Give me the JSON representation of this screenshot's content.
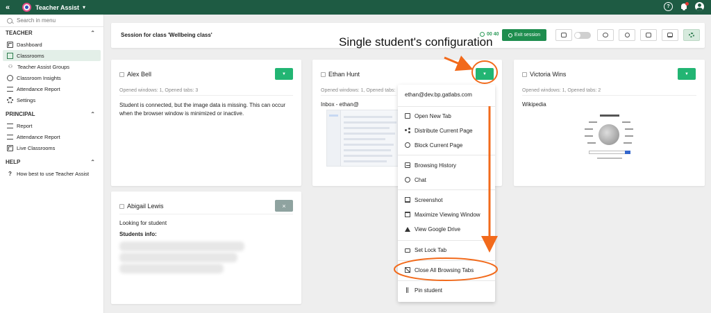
{
  "app": {
    "title": "Teacher Assist"
  },
  "sidebar": {
    "search_placeholder": "Search in menu",
    "sections": [
      {
        "title": "TEACHER",
        "items": [
          "Dashboard",
          "Classrooms",
          "Teacher Assist Groups",
          "Classroom Insights",
          "Attendance Report",
          "Settings"
        ]
      },
      {
        "title": "PRINCIPAL",
        "items": [
          "Report",
          "Attendance Report",
          "Live Classrooms"
        ]
      },
      {
        "title": "HELP",
        "items": [
          "How best to use Teacher Assist"
        ]
      }
    ],
    "active_item": "Classrooms"
  },
  "session": {
    "title": "Session for class 'Wellbeing class'",
    "timer": "00 40",
    "exit_label": "Exit session"
  },
  "annotation": {
    "title": "Single student's configuration"
  },
  "students": {
    "alex": {
      "name": "Alex Bell",
      "meta": "Opened windows: 1, Opened tabs: 3",
      "message": "Student is connected, but the image data is missing. This can occur when the browser window is minimized or inactive."
    },
    "ethan": {
      "name": "Ethan Hunt",
      "meta": "Opened windows: 1, Opened tabs:",
      "tab_title": "Inbox - ethan@"
    },
    "victoria": {
      "name": "Victoria Wins",
      "meta": "Opened windows: 1, Opened tabs: 2",
      "tab_title": "Wikipedia"
    },
    "abigail": {
      "name": "Abigail Lewis",
      "status": "Looking for student",
      "info_label": "Students info:"
    }
  },
  "student_menu": {
    "email": "ethan@dev.bp.gatlabs.com",
    "items": [
      {
        "label": "Open New Tab",
        "icon": "new-tab-icon"
      },
      {
        "label": "Distribute Current Page",
        "icon": "share-icon"
      },
      {
        "label": "Block Current Page",
        "icon": "block-icon"
      },
      {
        "label": "Browsing History",
        "icon": "history-icon"
      },
      {
        "label": "Chat",
        "icon": "chat-icon"
      },
      {
        "label": "Screenshot",
        "icon": "screenshot-icon"
      },
      {
        "label": "Maximize Viewing Window",
        "icon": "maximize-icon"
      },
      {
        "label": "View Google Drive",
        "icon": "drive-icon"
      },
      {
        "label": "Set Lock Tab",
        "icon": "lock-icon"
      },
      {
        "label": "Close All Browsing Tabs",
        "icon": "close-tabs-icon"
      },
      {
        "label": "Pin student",
        "icon": "pin-icon"
      }
    ]
  },
  "colors": {
    "topbar": "#1e5b43",
    "accent": "#22b573",
    "annotation": "#f26a1b"
  }
}
